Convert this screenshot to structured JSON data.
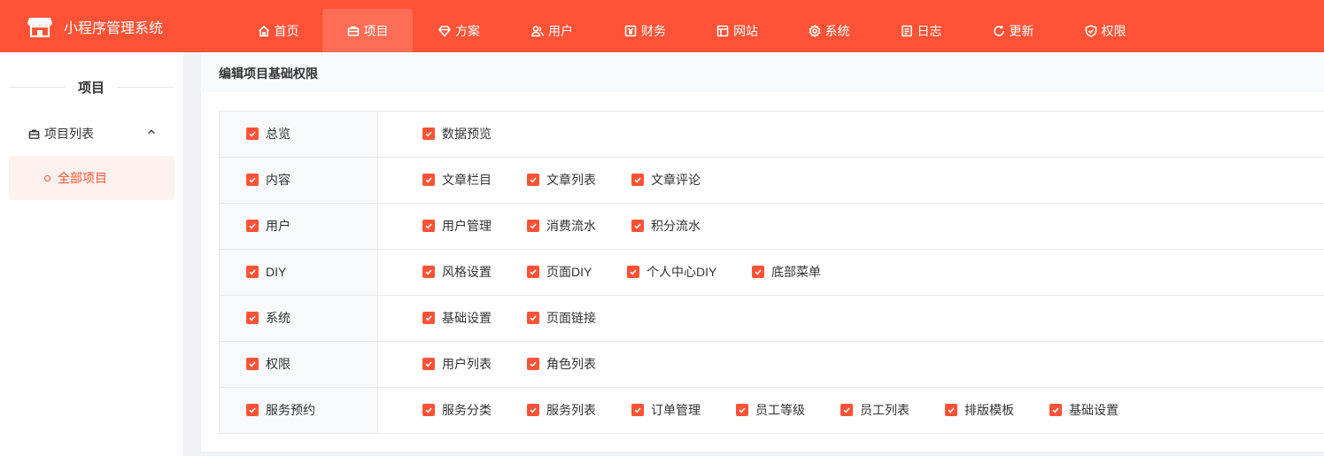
{
  "app": {
    "title": "小程序管理系统"
  },
  "nav": [
    {
      "label": "首页",
      "icon": "home-icon"
    },
    {
      "label": "项目",
      "icon": "briefcase-icon",
      "active": true
    },
    {
      "label": "方案",
      "icon": "diamond-icon"
    },
    {
      "label": "用户",
      "icon": "users-icon"
    },
    {
      "label": "财务",
      "icon": "yen-icon"
    },
    {
      "label": "网站",
      "icon": "layout-icon"
    },
    {
      "label": "系统",
      "icon": "gear-icon"
    },
    {
      "label": "日志",
      "icon": "document-icon"
    },
    {
      "label": "更新",
      "icon": "refresh-icon"
    },
    {
      "label": "权限",
      "icon": "shield-icon"
    }
  ],
  "sidebar": {
    "title": "项目",
    "group": {
      "label": "项目列表"
    },
    "items": [
      {
        "label": "全部项目",
        "active": true
      }
    ]
  },
  "main": {
    "title": "编辑项目基础权限",
    "permissions": [
      {
        "label": "总览",
        "checked": true,
        "children": [
          {
            "label": "数据预览",
            "checked": true
          }
        ]
      },
      {
        "label": "内容",
        "checked": true,
        "children": [
          {
            "label": "文章栏目",
            "checked": true
          },
          {
            "label": "文章列表",
            "checked": true
          },
          {
            "label": "文章评论",
            "checked": true
          }
        ]
      },
      {
        "label": "用户",
        "checked": true,
        "children": [
          {
            "label": "用户管理",
            "checked": true
          },
          {
            "label": "消费流水",
            "checked": true
          },
          {
            "label": "积分流水",
            "checked": true
          }
        ]
      },
      {
        "label": "DIY",
        "checked": true,
        "children": [
          {
            "label": "风格设置",
            "checked": true
          },
          {
            "label": "页面DIY",
            "checked": true
          },
          {
            "label": "个人中心DIY",
            "checked": true
          },
          {
            "label": "底部菜单",
            "checked": true
          }
        ]
      },
      {
        "label": "系统",
        "checked": true,
        "children": [
          {
            "label": "基础设置",
            "checked": true
          },
          {
            "label": "页面链接",
            "checked": true
          }
        ]
      },
      {
        "label": "权限",
        "checked": true,
        "children": [
          {
            "label": "用户列表",
            "checked": true
          },
          {
            "label": "角色列表",
            "checked": true
          }
        ]
      },
      {
        "label": "服务预约",
        "checked": true,
        "children": [
          {
            "label": "服务分类",
            "checked": true
          },
          {
            "label": "服务列表",
            "checked": true
          },
          {
            "label": "订单管理",
            "checked": true
          },
          {
            "label": "员工等级",
            "checked": true
          },
          {
            "label": "员工列表",
            "checked": true
          },
          {
            "label": "排版模板",
            "checked": true
          },
          {
            "label": "基础设置",
            "checked": true
          }
        ]
      }
    ]
  },
  "colors": {
    "accent": "#ff5236",
    "accent_light": "#fff1ee"
  }
}
